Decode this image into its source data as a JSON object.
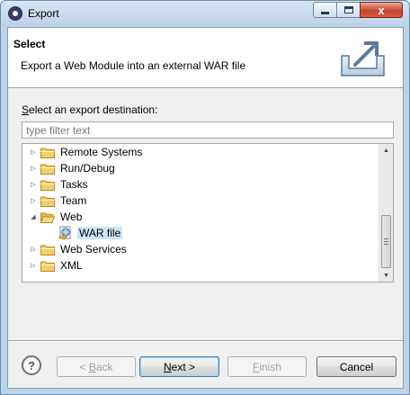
{
  "window": {
    "title": "Export",
    "close_glyph": "x"
  },
  "banner": {
    "title": "Select",
    "description": "Export a Web Module into an external WAR file",
    "icon": "export-icon"
  },
  "destination": {
    "label_mnemonic": "S",
    "label_rest": "elect an export destination:",
    "filter_placeholder": "type filter text",
    "filter_value": ""
  },
  "tree": {
    "items": [
      {
        "label": "Remote Systems",
        "expanded": false,
        "level": 0,
        "icon": "folder-icon"
      },
      {
        "label": "Run/Debug",
        "expanded": false,
        "level": 0,
        "icon": "folder-icon"
      },
      {
        "label": "Tasks",
        "expanded": false,
        "level": 0,
        "icon": "folder-icon"
      },
      {
        "label": "Team",
        "expanded": false,
        "level": 0,
        "icon": "folder-icon"
      },
      {
        "label": "Web",
        "expanded": true,
        "level": 0,
        "icon": "folder-icon"
      },
      {
        "label": "WAR file",
        "expanded": null,
        "level": 1,
        "icon": "war-file-icon",
        "selected": true
      },
      {
        "label": "Web Services",
        "expanded": false,
        "level": 0,
        "icon": "folder-icon"
      },
      {
        "label": "XML",
        "expanded": false,
        "level": 0,
        "icon": "folder-icon"
      }
    ]
  },
  "buttons": {
    "back_prefix": "< ",
    "back_mnemonic": "B",
    "back_rest": "ack",
    "next_mnemonic": "N",
    "next_rest": "ext >",
    "finish_mnemonic": "F",
    "finish_rest": "inish",
    "cancel": "Cancel",
    "help": "?"
  },
  "colors": {
    "selection": "#cce4f7",
    "window_frame": "#bcd3ea",
    "close_button": "#c7452d"
  }
}
